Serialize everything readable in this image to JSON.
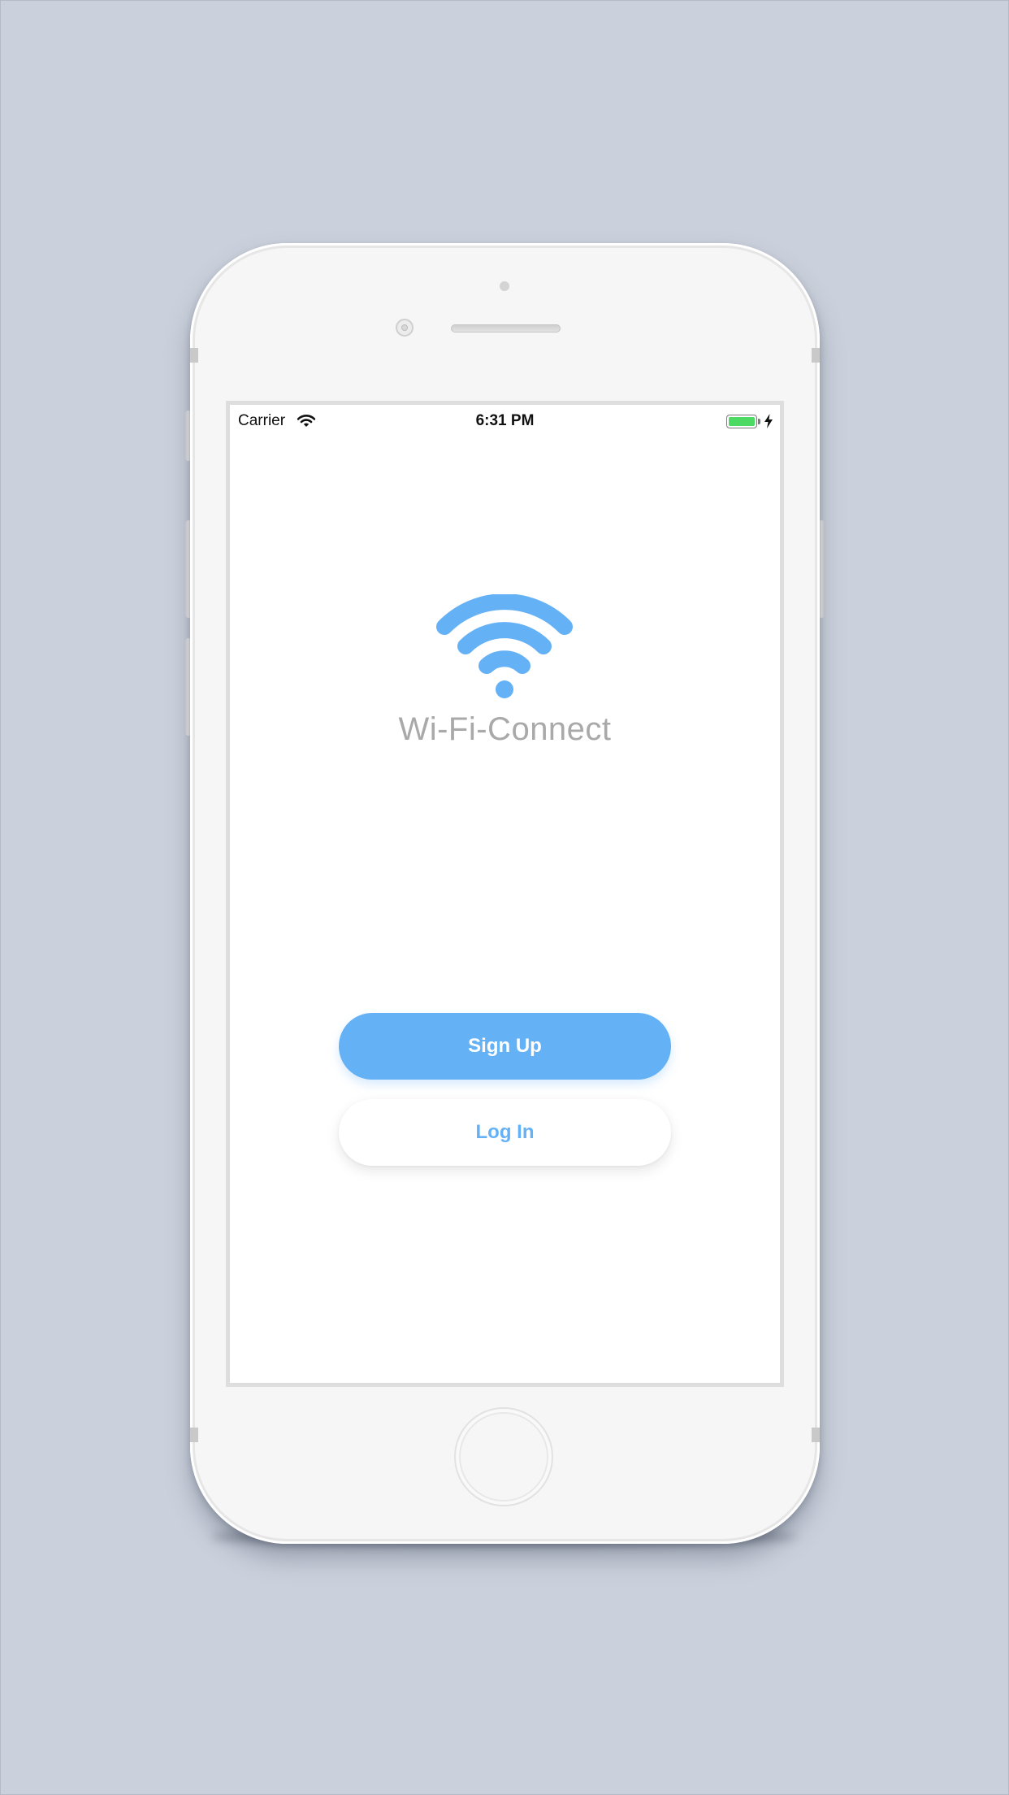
{
  "status_bar": {
    "carrier": "Carrier",
    "time": "6:31 PM",
    "battery_level": 1.0,
    "charging": true
  },
  "app": {
    "title": "Wi-Fi-Connect",
    "logo_icon": "wifi-icon"
  },
  "actions": {
    "signup_label": "Sign Up",
    "login_label": "Log In"
  },
  "colors": {
    "accent": "#64b1f6",
    "title_gray": "#a9a9a9",
    "background": "#cbd1dc",
    "battery_green": "#4cd964"
  }
}
